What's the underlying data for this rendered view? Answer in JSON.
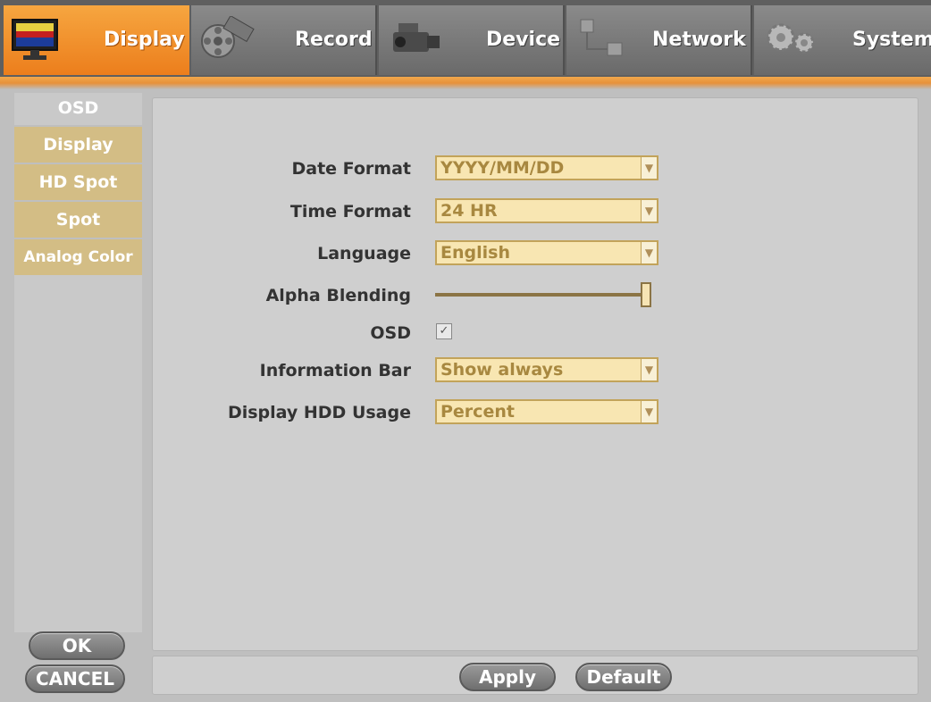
{
  "tabs": [
    {
      "label": "Display",
      "icon": "monitor-icon",
      "active": true
    },
    {
      "label": "Record",
      "icon": "film-reel-icon",
      "active": false
    },
    {
      "label": "Device",
      "icon": "camcorder-icon",
      "active": false
    },
    {
      "label": "Network",
      "icon": "network-icon",
      "active": false
    },
    {
      "label": "System",
      "icon": "gears-icon",
      "active": false
    }
  ],
  "sidebar": {
    "items": [
      {
        "label": "OSD",
        "active": true
      },
      {
        "label": "Display",
        "active": false
      },
      {
        "label": "HD Spot",
        "active": false
      },
      {
        "label": "Spot",
        "active": false
      },
      {
        "label": "Analog Color",
        "active": false
      }
    ],
    "ok_label": "OK",
    "cancel_label": "CANCEL"
  },
  "form": {
    "date_format": {
      "label": "Date Format",
      "value": "YYYY/MM/DD"
    },
    "time_format": {
      "label": "Time Format",
      "value": "24 HR"
    },
    "language": {
      "label": "Language",
      "value": "English"
    },
    "alpha_blending": {
      "label": "Alpha Blending",
      "level": 1.0
    },
    "osd": {
      "label": "OSD",
      "checked": true
    },
    "information_bar": {
      "label": "Information Bar",
      "value": "Show always"
    },
    "display_hdd_usage": {
      "label": "Display HDD Usage",
      "value": "Percent"
    }
  },
  "footer": {
    "apply_label": "Apply",
    "default_label": "Default"
  },
  "colors": {
    "active_tab": "#ec7e1c",
    "sidebar_item": "#d3bd85",
    "select_bg": "#f8e6b2",
    "select_text": "#a88840"
  }
}
